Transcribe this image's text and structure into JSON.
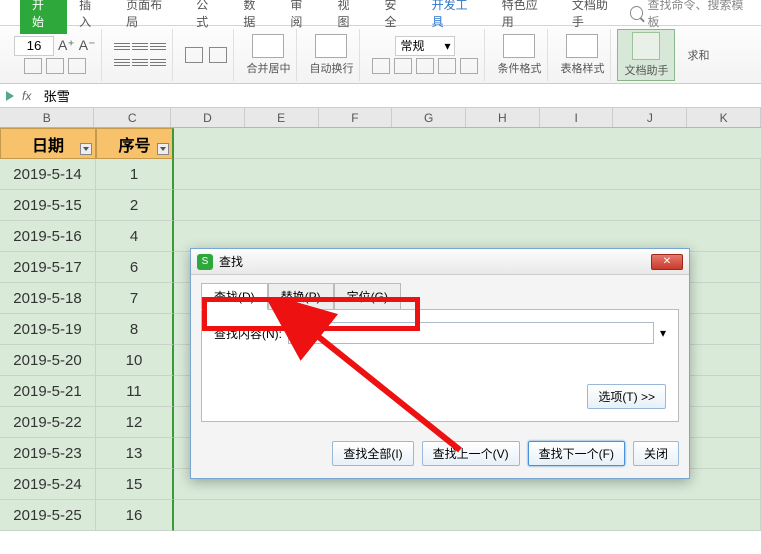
{
  "tabs": {
    "t0": "开始",
    "t1": "插入",
    "t2": "页面布局",
    "t3": "公式",
    "t4": "数据",
    "t5": "审阅",
    "t6": "视图",
    "t7": "安全",
    "t8": "开发工具",
    "t9": "特色应用",
    "t10": "文档助手"
  },
  "search_placeholder": "查找命令、搜索模板",
  "ribbon": {
    "font_size": "16",
    "format_general": "常规",
    "merge": "合并居中",
    "wrap": "自动换行",
    "cond": "条件格式",
    "table": "表格样式",
    "doc": "文档助手",
    "sum": "求和"
  },
  "formula_bar": {
    "fx": "fx",
    "value": "张雪"
  },
  "col_headers": [
    "B",
    "C",
    "D",
    "E",
    "F",
    "G",
    "H",
    "I",
    "J",
    "K"
  ],
  "table": {
    "h1": "日期",
    "h2": "序号",
    "rows": [
      {
        "d": "2019-5-14",
        "n": "1"
      },
      {
        "d": "2019-5-15",
        "n": "2"
      },
      {
        "d": "2019-5-16",
        "n": "4"
      },
      {
        "d": "2019-5-17",
        "n": "6"
      },
      {
        "d": "2019-5-18",
        "n": "7"
      },
      {
        "d": "2019-5-19",
        "n": "8"
      },
      {
        "d": "2019-5-20",
        "n": "10"
      },
      {
        "d": "2019-5-21",
        "n": "11"
      },
      {
        "d": "2019-5-22",
        "n": "12"
      },
      {
        "d": "2019-5-23",
        "n": "13"
      },
      {
        "d": "2019-5-24",
        "n": "15"
      },
      {
        "d": "2019-5-25",
        "n": "16"
      }
    ]
  },
  "dialog": {
    "title": "查找",
    "tab_find": "查找(D)",
    "tab_replace": "替换(P)",
    "tab_goto": "定位(G)",
    "label_content": "查找内容(N):",
    "input_value": "",
    "options": "选项(T) >>",
    "find_all": "查找全部(I)",
    "find_prev": "查找上一个(V)",
    "find_next": "查找下一个(F)",
    "close": "关闭"
  }
}
